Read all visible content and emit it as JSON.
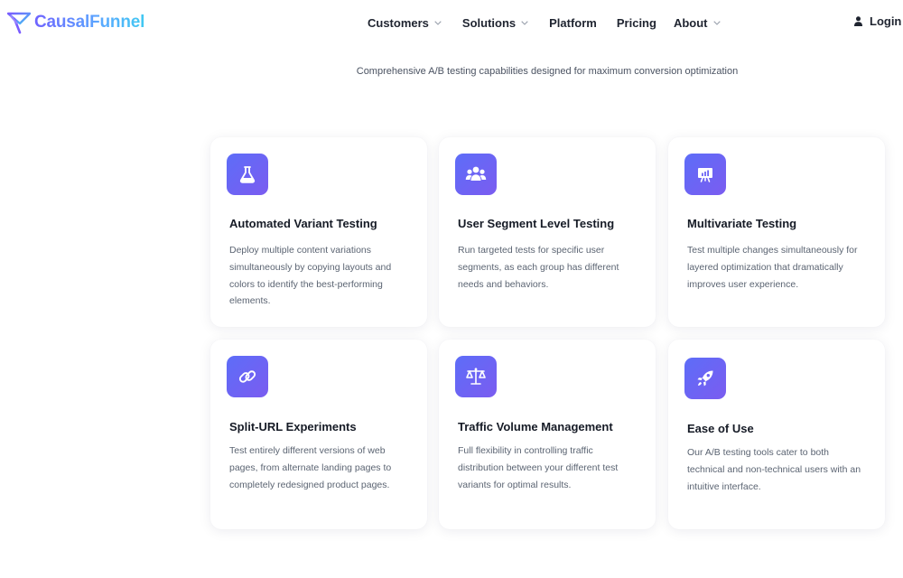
{
  "brand": {
    "name": "CausalFunnel",
    "colors": {
      "accent_start": "#6f63ff",
      "accent_end": "#41c9f2",
      "icon_gradient_start": "#5d6df8",
      "icon_gradient_end": "#7b5cf0"
    }
  },
  "nav": {
    "items": [
      {
        "label": "Customers",
        "has_dropdown": true
      },
      {
        "label": "Solutions",
        "has_dropdown": true
      },
      {
        "label": "Platform",
        "has_dropdown": false
      },
      {
        "label": "Pricing",
        "has_dropdown": false
      },
      {
        "label": "About",
        "has_dropdown": true
      }
    ],
    "login_label": "Login",
    "login_icon": "user-icon"
  },
  "section": {
    "subtitle": "Comprehensive A/B testing capabilities designed for maximum conversion optimization"
  },
  "features": [
    {
      "icon": "flask-icon",
      "title": "Automated Variant Testing",
      "description": "Deploy multiple content variations simultaneously by copying layouts and colors to identify the best-performing elements."
    },
    {
      "icon": "users-group-icon",
      "title": "User Segment Level Testing",
      "description": "Run targeted tests for specific user segments, as each group has different needs and behaviors."
    },
    {
      "icon": "presentation-chart-icon",
      "title": "Multivariate Testing",
      "description": "Test multiple changes simultaneously for layered optimization that dramatically improves user experience."
    },
    {
      "icon": "link-icon",
      "title": "Split-URL Experiments",
      "description": "Test entirely different versions of web pages, from alternate landing pages to completely redesigned product pages."
    },
    {
      "icon": "balance-scale-icon",
      "title": "Traffic Volume Management",
      "description": "Full flexibility in controlling traffic distribution between your different test variants for optimal results."
    },
    {
      "icon": "rocket-icon",
      "title": "Ease of Use",
      "description": "Our A/B testing tools cater to both technical and non-technical users with an intuitive interface."
    }
  ]
}
